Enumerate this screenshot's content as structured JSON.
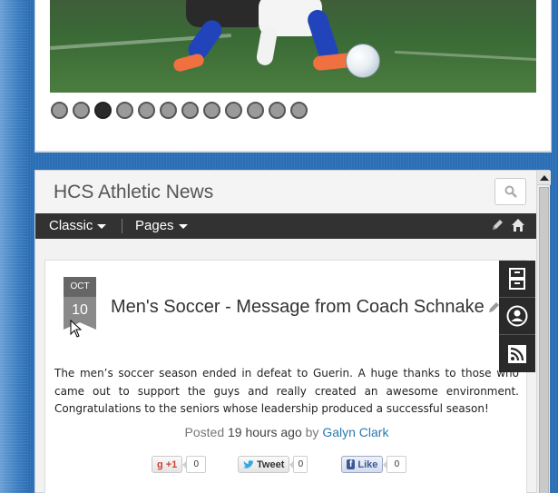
{
  "slider": {
    "dot_count": 12,
    "active_index": 2
  },
  "news": {
    "title": "HCS Athletic News",
    "search_icon": "search-icon",
    "nav": {
      "classic_label": "Classic",
      "pages_label": "Pages",
      "edit_icon": "pencil-icon",
      "home_icon": "home-icon"
    }
  },
  "post": {
    "month": "OCT",
    "day": "10",
    "title": "Men's Soccer - Message from Coach Schnake",
    "body": "The men’s soccer season ended in defeat to Guerin.  A huge thanks to those who came out to support the guys and really created an awesome environment.  Congratulations to the seniors whose leadership produced a successful season!",
    "meta": {
      "posted_label": "Posted",
      "time": "19 hours ago",
      "by_label": "by",
      "author": "Galyn Clark"
    },
    "social": {
      "gplus_label": "+1",
      "gplus_count": "0",
      "tweet_label": "Tweet",
      "tweet_count": "0",
      "like_label": "Like",
      "like_count": "0"
    }
  },
  "side_tools": [
    "archive-icon",
    "profile-icon",
    "rss-icon"
  ],
  "colors": {
    "background_blue": "#2a6eb5",
    "navbar": "#323232",
    "author_link": "#2a7ab0"
  }
}
